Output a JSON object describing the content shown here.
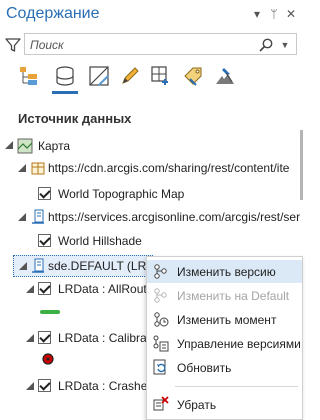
{
  "pane": {
    "title": "Содержание",
    "controls": {
      "dropdown": "▾",
      "pin": "ᛘ",
      "close": "✕"
    }
  },
  "search": {
    "placeholder": "Поиск"
  },
  "toolbar": {
    "tools": [
      {
        "name": "drawing-order-icon",
        "active": false
      },
      {
        "name": "data-source-icon",
        "active": true
      },
      {
        "name": "selection-icon",
        "active": false
      },
      {
        "name": "editing-icon",
        "active": false
      },
      {
        "name": "snapping-icon",
        "active": false
      },
      {
        "name": "labeling-icon",
        "active": false
      },
      {
        "name": "perspective-imagery-icon",
        "active": false
      }
    ]
  },
  "section_title": "Источник данных",
  "tree": {
    "map": "Карта",
    "source1": "https://cdn.arcgis.com/sharing/rest/content/ite",
    "layer_topo": "World Topographic Map",
    "source2": "https://services.arcgisonline.com/arcgis/rest/ser",
    "layer_hillshade": "World Hillshade",
    "source3": "sde.DEFAULT (LRD",
    "layer_allroutes": "LRData : AllRoute",
    "layer_calibration": "LRData : Calibrat",
    "layer_crashes": "LRData : Crashes"
  },
  "context_menu": {
    "items": [
      {
        "label": "Изменить версию",
        "icon": "change-version-icon",
        "highlighted": true,
        "disabled": false
      },
      {
        "label": "Изменить на Default",
        "icon": "change-to-default-icon",
        "highlighted": false,
        "disabled": true
      },
      {
        "label": "Изменить момент",
        "icon": "change-moment-icon",
        "highlighted": false,
        "disabled": false
      },
      {
        "label": "Управление версиями",
        "icon": "manage-versions-icon",
        "highlighted": false,
        "disabled": false
      },
      {
        "label": "Обновить",
        "icon": "refresh-icon",
        "highlighted": false,
        "disabled": false
      },
      {
        "label": "Убрать",
        "icon": "remove-icon",
        "highlighted": false,
        "disabled": false
      }
    ]
  },
  "colors": {
    "accent": "#2a6fb5",
    "route_symbol": "#3cb043",
    "calibration_symbol": "#cc0000",
    "menu_highlight": "#dbe9f7"
  }
}
